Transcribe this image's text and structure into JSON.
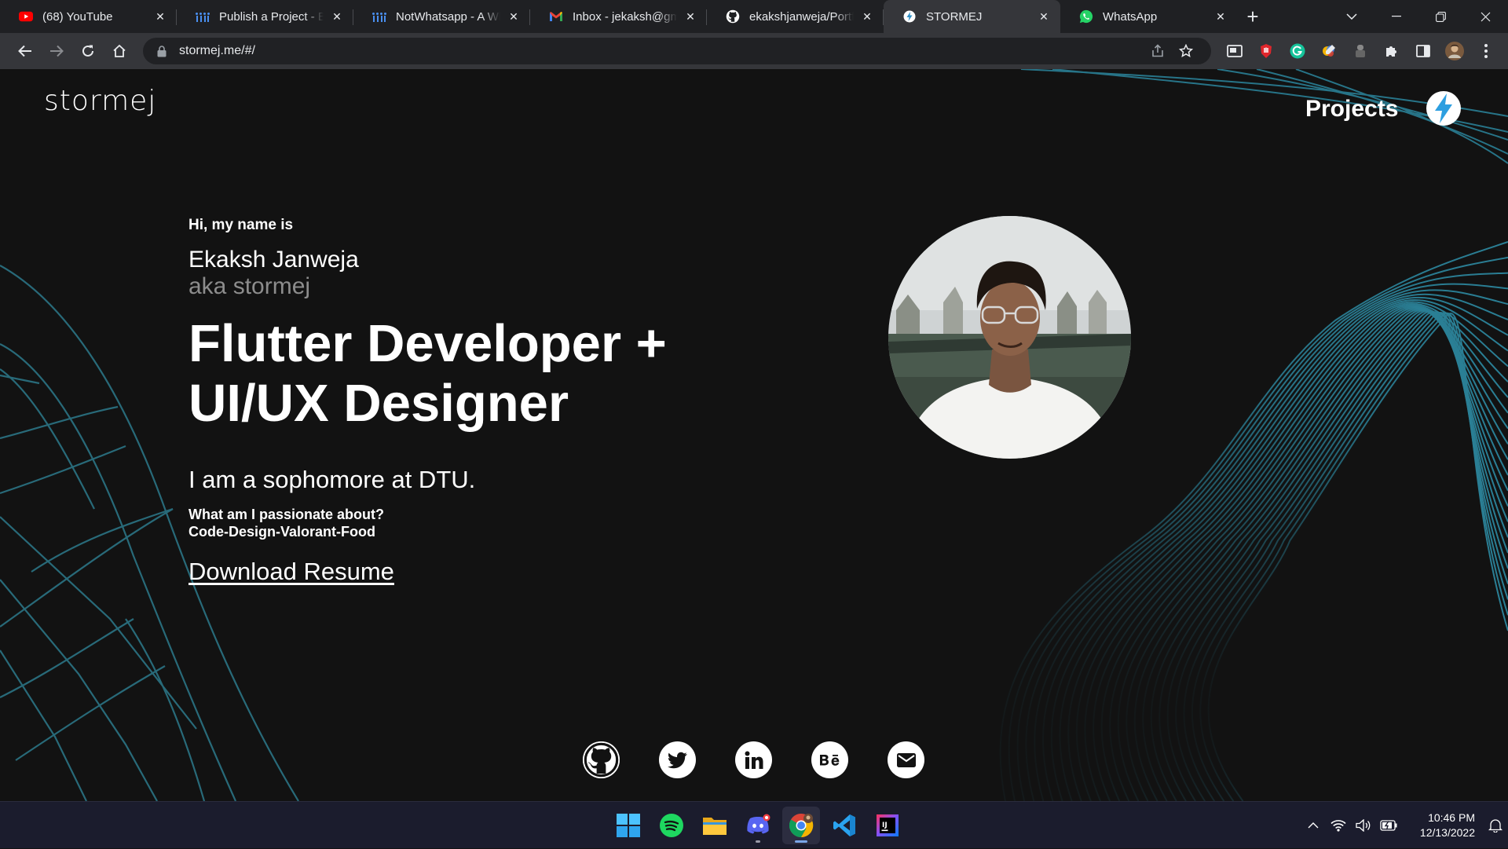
{
  "browser": {
    "tabs": [
      {
        "title": "(68) YouTube",
        "favicon": "youtube-icon",
        "active": false
      },
      {
        "title": "Publish a Project - Build",
        "favicon": "devpost-icon",
        "active": false
      },
      {
        "title": "NotWhatsapp - A WhatsApp",
        "favicon": "devpost-icon",
        "active": false
      },
      {
        "title": "Inbox - jekaksh@gmail.com",
        "favicon": "gmail-icon",
        "active": false
      },
      {
        "title": "ekakshjanweja/Portfolio",
        "favicon": "github-icon",
        "active": false
      },
      {
        "title": "STORMEJ",
        "favicon": "stormej-icon",
        "active": true
      },
      {
        "title": "WhatsApp",
        "favicon": "whatsapp-icon",
        "active": false
      }
    ],
    "url": "stormej.me/#/"
  },
  "site": {
    "logo": "stormej",
    "nav_projects": "Projects",
    "greeting": "Hi, my name is",
    "name": "Ekaksh Janweja",
    "aka": "aka stormej",
    "headline_line1": "Flutter Developer +",
    "headline_line2": "UI/UX Designer",
    "intro": "I am a sophomore at DTU.",
    "passion_question": "What am I passionate about?",
    "passion_answer": "Code-Design-Valorant-Food",
    "resume_link": "Download Resume",
    "socials": [
      "github-icon",
      "twitter-icon",
      "linkedin-icon",
      "behance-icon",
      "mail-icon"
    ],
    "accent_color": "#2a7f95"
  },
  "taskbar": {
    "apps": [
      "windows-start-icon",
      "spotify-icon",
      "file-explorer-icon",
      "discord-icon",
      "chrome-icon",
      "vscode-icon",
      "intellij-icon"
    ],
    "time": "10:46 PM",
    "date": "12/13/2022"
  }
}
